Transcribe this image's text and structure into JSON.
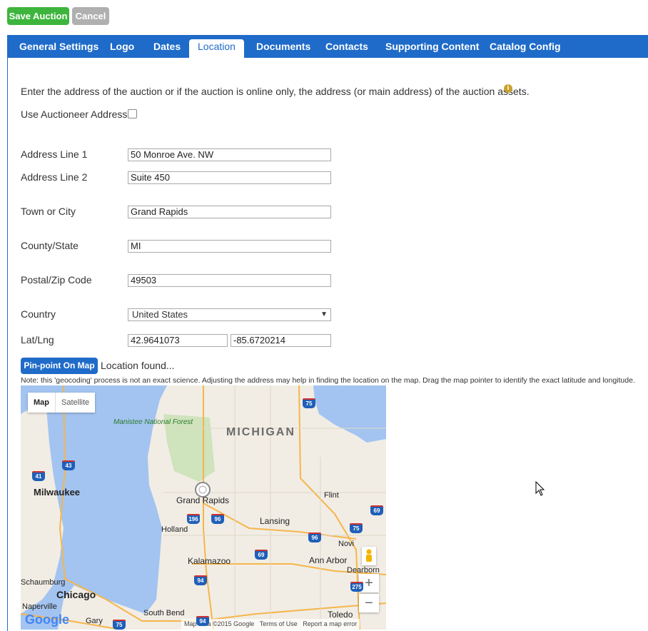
{
  "toolbar": {
    "save_label": "Save Auction",
    "cancel_label": "Cancel"
  },
  "tabs": [
    "General Settings",
    "Logo",
    "Dates",
    "Location",
    "Documents",
    "Contacts",
    "Supporting Content",
    "Catalog Config"
  ],
  "active_tab": "Location",
  "intro": "Enter the address of the auction or if the auction is online only, the address (or main address) of the auction assets.",
  "info_icon": "info-icon",
  "use_auctioneer_label": "Use Auctioneer Address",
  "fields": {
    "address1": {
      "label": "Address Line 1",
      "value": "50 Monroe Ave. NW"
    },
    "address2": {
      "label": "Address Line 2",
      "value": "Suite 450"
    },
    "city": {
      "label": "Town or City",
      "value": "Grand Rapids"
    },
    "state": {
      "label": "County/State",
      "value": "MI"
    },
    "zip": {
      "label": "Postal/Zip Code",
      "value": "49503"
    },
    "country": {
      "label": "Country",
      "value": "United States"
    },
    "latlng": {
      "label": "Lat/Lng",
      "lat": "42.9641073",
      "lng": "-85.6720214"
    }
  },
  "pin_button_label": "Pin-point On Map",
  "location_status": "Location found...",
  "note": "Note: this 'geocoding' process is not an exact science. Adjusting the address may help in finding the location on the map. Drag the map pointer to identify the exact latitude and longitude.",
  "map": {
    "type_map": "Map",
    "type_satellite": "Satellite",
    "zoom_in": "+",
    "zoom_out": "−",
    "attribution": "Map data ©2015 Google",
    "terms": "Terms of Use",
    "report": "Report a map error",
    "logo": "Google",
    "labels": {
      "state": "MICHIGAN",
      "forest": "Manistee National Forest",
      "milwaukee": "Milwaukee",
      "grand_rapids": "Grand Rapids",
      "holland": "Holland",
      "lansing": "Lansing",
      "flint": "Flint",
      "novi": "Novi",
      "kalamazoo": "Kalamazoo",
      "ann_arbor": "Ann Arbor",
      "dearborn": "Dearborn",
      "schaumburg": "Schaumburg",
      "chicago": "Chicago",
      "naperville": "Naperville",
      "south_bend": "South Bend",
      "toledo": "Toledo",
      "gary": "Gary"
    },
    "shields": [
      "75",
      "43",
      "41",
      "69",
      "196",
      "96",
      "96",
      "75",
      "69",
      "94",
      "275",
      "94",
      "75"
    ]
  }
}
